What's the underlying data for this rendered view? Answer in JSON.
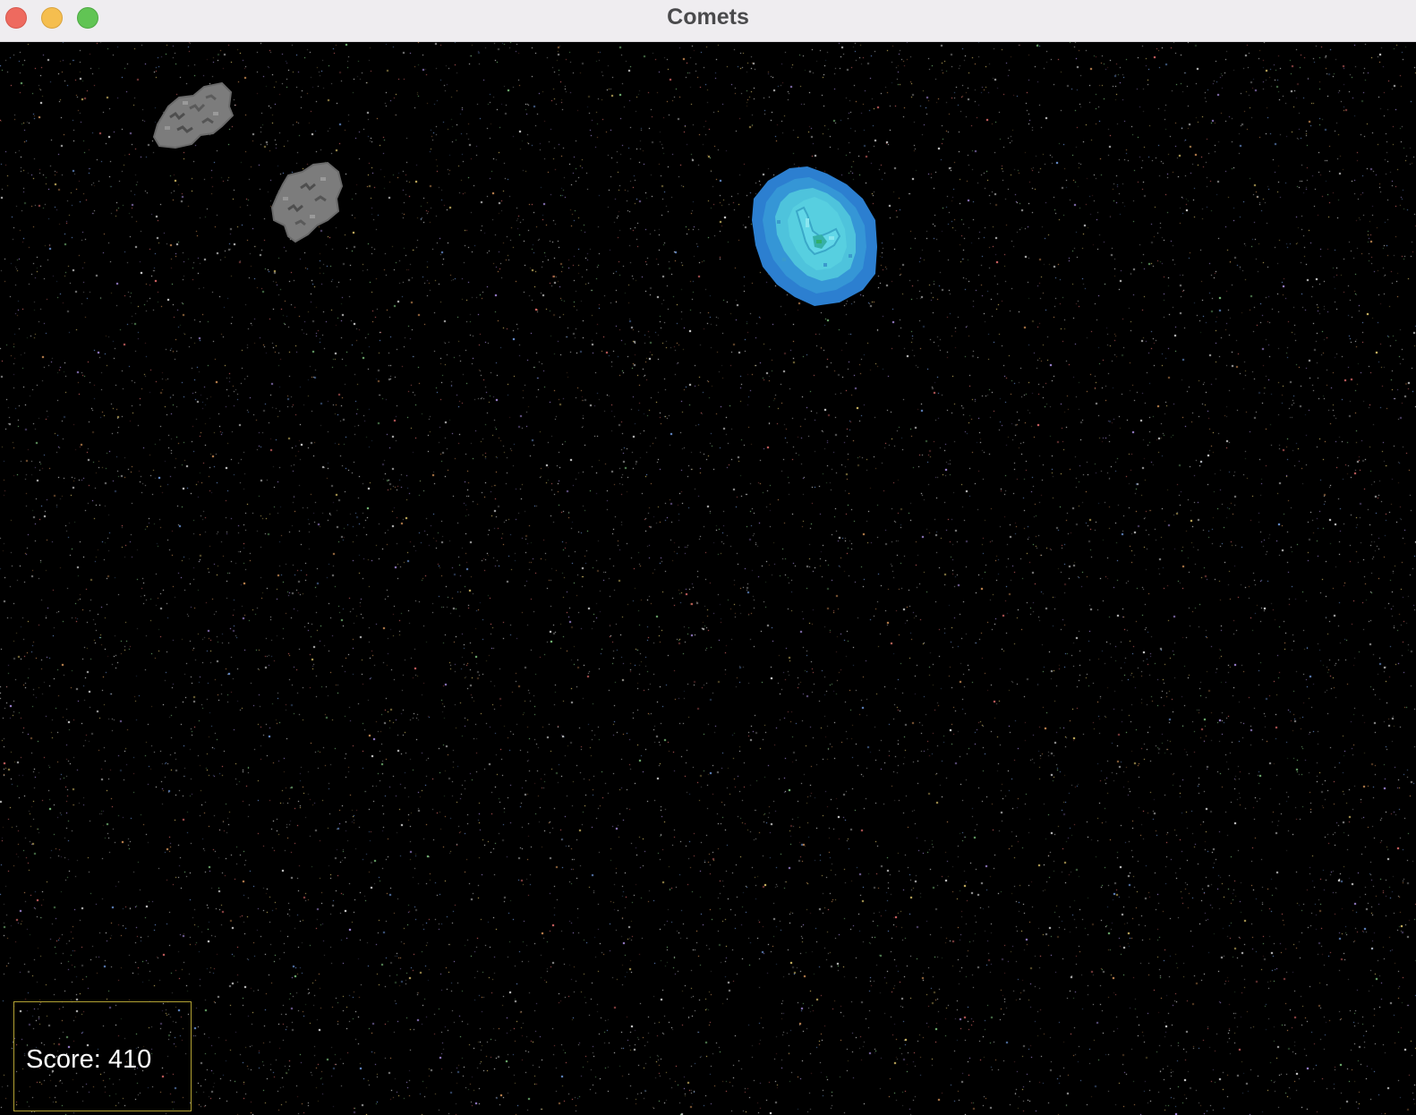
{
  "window": {
    "title": "Comets"
  },
  "hud": {
    "score_label": "Score: 410",
    "score": 410
  },
  "sprites": {
    "asteroids": [
      {
        "name": "asteroid-1",
        "icon": "gray-rock-asteroid"
      },
      {
        "name": "asteroid-2",
        "icon": "gray-rock-asteroid"
      }
    ],
    "player": {
      "icon": "spaceship-with-blue-shield"
    }
  },
  "colors": {
    "space_background": "#000000",
    "title_bar": "#efedf0",
    "score_border": "#b3a233",
    "shield_outer": "#2a7fd0",
    "shield_inner": "#4cc6dc",
    "asteroid": "#7a7a7a"
  }
}
